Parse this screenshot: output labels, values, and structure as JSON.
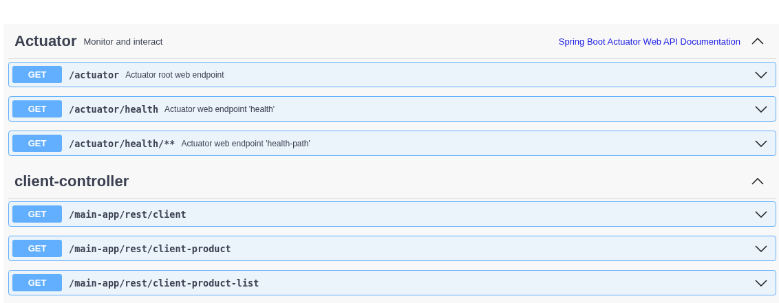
{
  "sections": [
    {
      "name": "Actuator",
      "description": "Monitor and interact",
      "link": "Spring Boot Actuator Web API Documentation",
      "expanded": true,
      "operations": [
        {
          "method": "GET",
          "path": "/actuator",
          "summary": "Actuator root web endpoint",
          "expanded": false
        },
        {
          "method": "GET",
          "path": "/actuator/health",
          "summary": "Actuator web endpoint 'health'",
          "expanded": false
        },
        {
          "method": "GET",
          "path": "/actuator/health/**",
          "summary": "Actuator web endpoint 'health-path'",
          "expanded": false
        }
      ]
    },
    {
      "name": "client-controller",
      "expanded": true,
      "operations": [
        {
          "method": "GET",
          "path": "/main-app/rest/client",
          "expanded": false
        },
        {
          "method": "GET",
          "path": "/main-app/rest/client-product",
          "expanded": false
        },
        {
          "method": "GET",
          "path": "/main-app/rest/client-product-list",
          "expanded": false
        }
      ]
    }
  ]
}
